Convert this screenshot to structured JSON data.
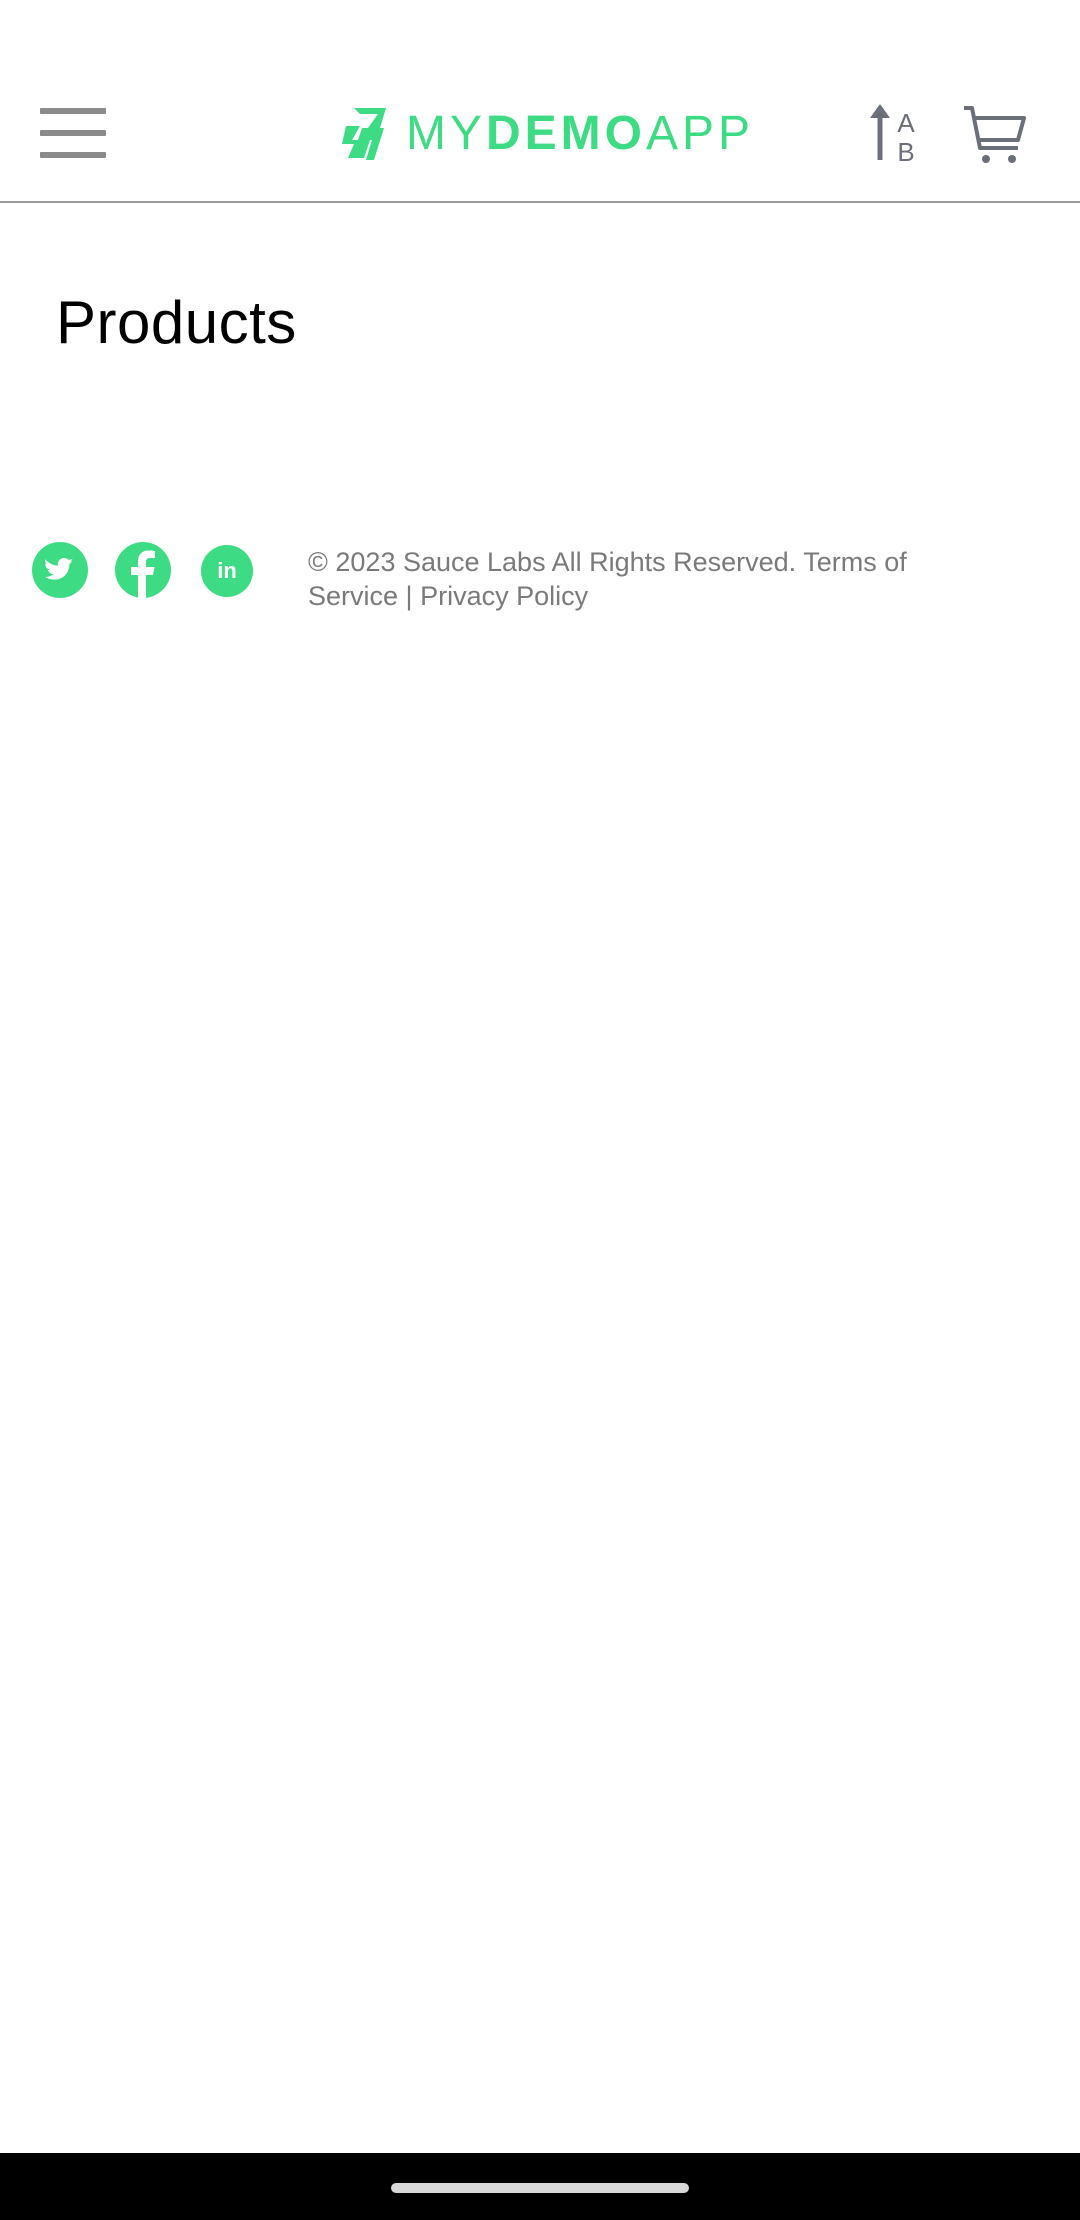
{
  "header": {
    "logo": {
      "part1": "MY",
      "part2": "DEMO",
      "part3": "APP"
    },
    "menu_icon": "hamburger-menu-icon",
    "sort_icon": "sort-az-icon",
    "cart_icon": "cart-icon"
  },
  "main": {
    "title": "Products"
  },
  "footer": {
    "social_icons": [
      "twitter-icon",
      "facebook-icon",
      "linkedin-icon"
    ],
    "linkedin_label": "in",
    "copyright": "© 2023 Sauce Labs All Rights Reserved.",
    "terms": "Terms of Service",
    "separator": "|",
    "privacy": "Privacy Policy"
  },
  "colors": {
    "brand": "#3ddc84",
    "icon_gray": "#6b6f7a",
    "menu_gray": "#8a8a8a",
    "footer_text": "#7a7a7a"
  }
}
